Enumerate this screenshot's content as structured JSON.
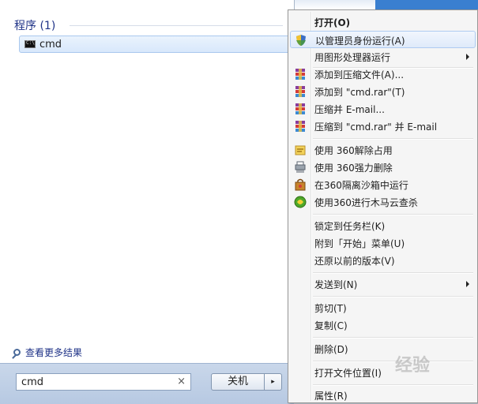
{
  "start_menu": {
    "section_header": "程序 (1)",
    "result": {
      "label": "cmd",
      "icon": "cmd-console-icon"
    },
    "more_results": "查看更多结果",
    "search": {
      "value": "cmd",
      "clear_glyph": "×"
    },
    "shutdown_label": "关机",
    "shutdown_arrow": "▸"
  },
  "context_menu": {
    "items": [
      {
        "label": "打开(O)",
        "bold": true
      },
      {
        "label": "以管理员身份运行(A)",
        "icon": "uac-shield-icon",
        "highlighted": true
      },
      {
        "label": "用图形处理器运行",
        "submenu": true
      },
      {
        "label": "添加到压缩文件(A)...",
        "icon": "winrar-icon"
      },
      {
        "label": "添加到 \"cmd.rar\"(T)",
        "icon": "winrar-icon"
      },
      {
        "label": "压缩并 E-mail...",
        "icon": "winrar-icon"
      },
      {
        "label": "压缩到 \"cmd.rar\" 并 E-mail",
        "icon": "winrar-icon"
      },
      {
        "label": "使用 360解除占用",
        "icon": "unlock-file-icon"
      },
      {
        "label": "使用 360强力删除",
        "icon": "shredder-icon"
      },
      {
        "label": "在360隔离沙箱中运行",
        "icon": "sandbox-icon"
      },
      {
        "label": "使用360进行木马云查杀",
        "icon": "360-scan-icon"
      },
      {
        "label": "锁定到任务栏(K)"
      },
      {
        "label": "附到「开始」菜单(U)"
      },
      {
        "label": "还原以前的版本(V)"
      },
      {
        "label": "发送到(N)",
        "submenu": true
      },
      {
        "label": "剪切(T)"
      },
      {
        "label": "复制(C)"
      },
      {
        "label": "删除(D)"
      },
      {
        "label": "打开文件位置(I)"
      },
      {
        "label": "属性(R)"
      }
    ]
  },
  "watermark": "经验",
  "colors": {
    "accent": "#1e3287",
    "highlight_border": "#aecbf1"
  }
}
